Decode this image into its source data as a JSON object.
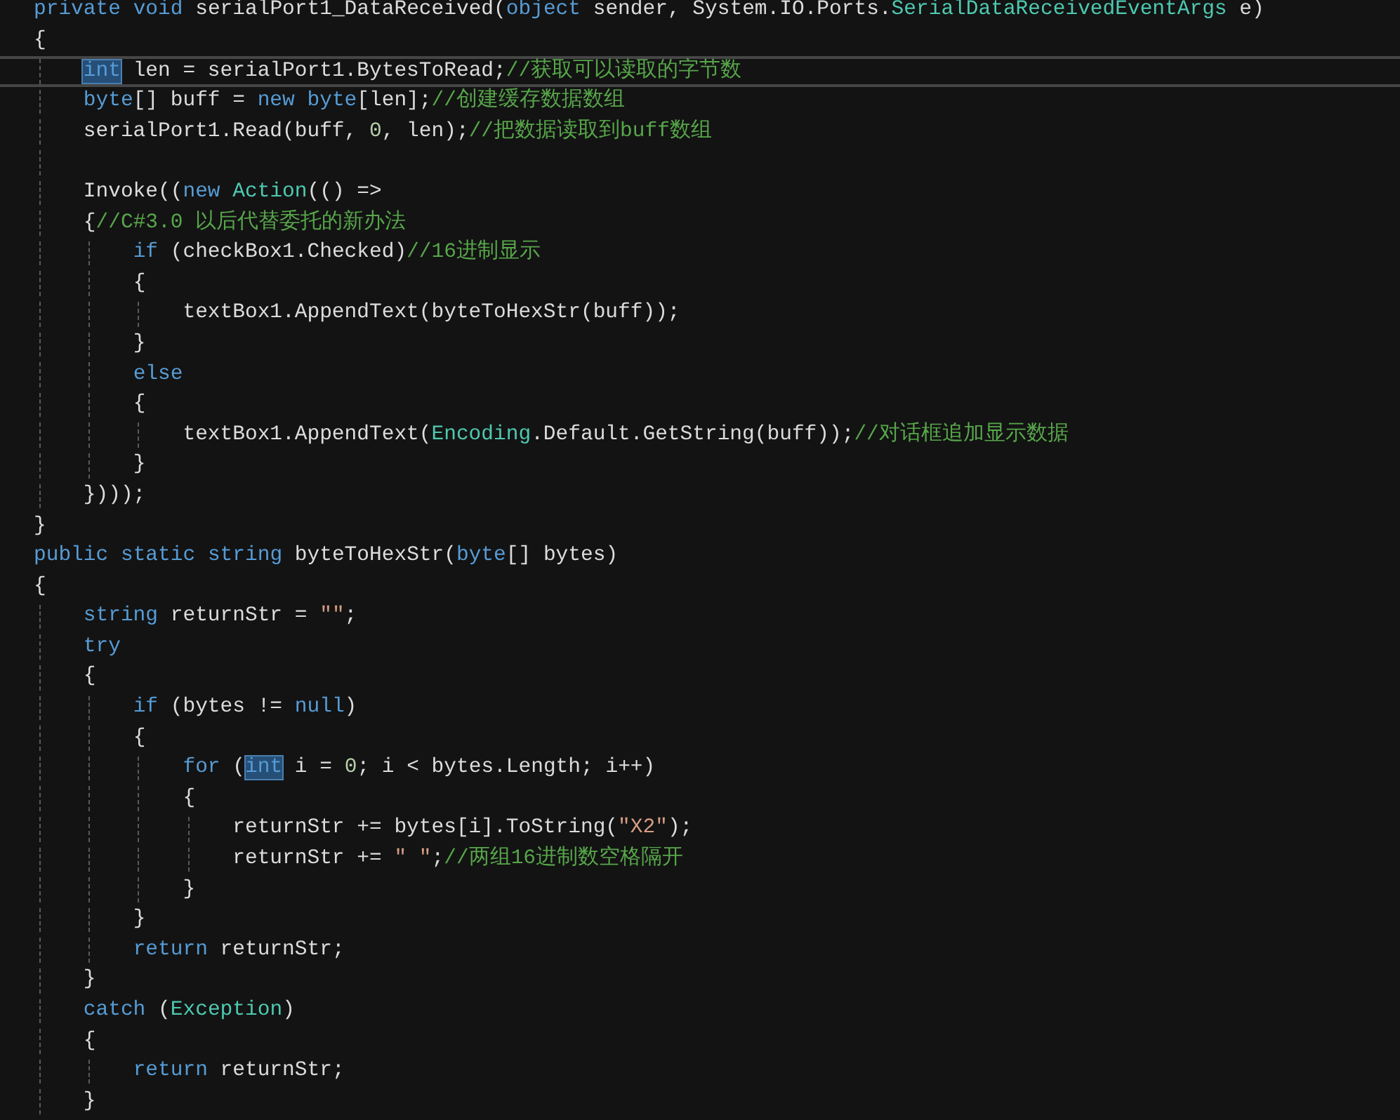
{
  "editor": {
    "lines": [
      {
        "current": false,
        "tokens": [
          {
            "kind": "keyword",
            "text": "private"
          },
          {
            "kind": "keyword",
            "text": " void"
          },
          {
            "kind": "plain",
            "text": " serialPort1_DataReceived("
          },
          {
            "kind": "keyword",
            "text": "object"
          },
          {
            "kind": "plain",
            "text": " sender, System.IO.Ports."
          },
          {
            "kind": "type",
            "text": "SerialDataReceivedEventArgs"
          },
          {
            "kind": "plain",
            "text": " e)"
          }
        ]
      },
      {
        "current": false,
        "tokens": [
          {
            "kind": "plain",
            "text": "{"
          }
        ]
      },
      {
        "current": true,
        "tokens": [
          {
            "kind": "match",
            "text": "    int"
          },
          {
            "kind": "plain",
            "text": " len = serialPort1.BytesToRead;"
          },
          {
            "kind": "comment",
            "text": "//获取可以读取的字节数"
          }
        ]
      },
      {
        "current": false,
        "tokens": [
          {
            "kind": "keyword",
            "text": "    byte"
          },
          {
            "kind": "plain",
            "text": "[] buff = "
          },
          {
            "kind": "keyword",
            "text": "new"
          },
          {
            "kind": "keyword",
            "text": " byte"
          },
          {
            "kind": "plain",
            "text": "[len];"
          },
          {
            "kind": "comment",
            "text": "//创建缓存数据数组"
          }
        ]
      },
      {
        "current": false,
        "tokens": [
          {
            "kind": "plain",
            "text": "    serialPort1.Read(buff, "
          },
          {
            "kind": "number",
            "text": "0"
          },
          {
            "kind": "plain",
            "text": ", len);"
          },
          {
            "kind": "comment",
            "text": "//把数据读取到buff数组"
          }
        ]
      },
      {
        "current": false
      },
      {
        "current": false,
        "tokens": [
          {
            "kind": "plain",
            "text": "    Invoke(("
          },
          {
            "kind": "keyword",
            "text": "new"
          },
          {
            "kind": "type",
            "text": " Action"
          },
          {
            "kind": "plain",
            "text": "(() =>"
          }
        ]
      },
      {
        "current": false,
        "tokens": [
          {
            "kind": "plain",
            "text": "    {"
          },
          {
            "kind": "comment",
            "text": "//C#3.0 以后代替委托的新办法"
          }
        ]
      },
      {
        "current": false,
        "tokens": [
          {
            "kind": "keyword",
            "text": "        if"
          },
          {
            "kind": "plain",
            "text": " (checkBox1.Checked)"
          },
          {
            "kind": "comment",
            "text": "//16进制显示"
          }
        ]
      },
      {
        "current": false,
        "tokens": [
          {
            "kind": "plain",
            "text": "        {"
          }
        ]
      },
      {
        "current": false,
        "tokens": [
          {
            "kind": "plain",
            "text": "            textBox1.AppendText(byteToHexStr(buff));"
          }
        ]
      },
      {
        "current": false,
        "tokens": [
          {
            "kind": "plain",
            "text": "        }"
          }
        ]
      },
      {
        "current": false,
        "tokens": [
          {
            "kind": "keyword",
            "text": "        else"
          }
        ]
      },
      {
        "current": false,
        "tokens": [
          {
            "kind": "plain",
            "text": "        {"
          }
        ]
      },
      {
        "current": false,
        "tokens": [
          {
            "kind": "plain",
            "text": "            textBox1.AppendText("
          },
          {
            "kind": "type",
            "text": "Encoding"
          },
          {
            "kind": "plain",
            "text": ".Default.GetString(buff));"
          },
          {
            "kind": "comment",
            "text": "//对话框追加显示数据"
          }
        ]
      },
      {
        "current": false,
        "tokens": [
          {
            "kind": "plain",
            "text": "        }"
          }
        ]
      },
      {
        "current": false,
        "tokens": [
          {
            "kind": "plain",
            "text": "    })));"
          }
        ]
      },
      {
        "current": false,
        "tokens": [
          {
            "kind": "plain",
            "text": "}"
          }
        ]
      },
      {
        "current": false,
        "tokens": [
          {
            "kind": "keyword",
            "text": "public"
          },
          {
            "kind": "keyword",
            "text": " static"
          },
          {
            "kind": "keyword",
            "text": " string"
          },
          {
            "kind": "plain",
            "text": " byteToHexStr("
          },
          {
            "kind": "keyword",
            "text": "byte"
          },
          {
            "kind": "plain",
            "text": "[] bytes)"
          }
        ]
      },
      {
        "current": false,
        "tokens": [
          {
            "kind": "plain",
            "text": "{"
          }
        ]
      },
      {
        "current": false,
        "tokens": [
          {
            "kind": "keyword",
            "text": "    string"
          },
          {
            "kind": "plain",
            "text": " returnStr = "
          },
          {
            "kind": "string",
            "text": "\"\""
          },
          {
            "kind": "plain",
            "text": ";"
          }
        ]
      },
      {
        "current": false,
        "tokens": [
          {
            "kind": "keyword",
            "text": "    try"
          }
        ]
      },
      {
        "current": false,
        "tokens": [
          {
            "kind": "plain",
            "text": "    {"
          }
        ]
      },
      {
        "current": false,
        "tokens": [
          {
            "kind": "keyword",
            "text": "        if"
          },
          {
            "kind": "plain",
            "text": " (bytes != "
          },
          {
            "kind": "keyword",
            "text": "null"
          },
          {
            "kind": "plain",
            "text": ")"
          }
        ]
      },
      {
        "current": false,
        "tokens": [
          {
            "kind": "plain",
            "text": "        {"
          }
        ]
      },
      {
        "current": false,
        "tokens": [
          {
            "kind": "keyword",
            "text": "            for"
          },
          {
            "kind": "plain",
            "text": " ("
          },
          {
            "kind": "match",
            "text": "int"
          },
          {
            "kind": "plain",
            "text": " i = "
          },
          {
            "kind": "number",
            "text": "0"
          },
          {
            "kind": "plain",
            "text": "; i < bytes.Length; i++)"
          }
        ]
      },
      {
        "current": false,
        "tokens": [
          {
            "kind": "plain",
            "text": "            {"
          }
        ]
      },
      {
        "current": false,
        "tokens": [
          {
            "kind": "plain",
            "text": "                returnStr += bytes[i].ToString("
          },
          {
            "kind": "string",
            "text": "\"X2\""
          },
          {
            "kind": "plain",
            "text": ");"
          }
        ]
      },
      {
        "current": false,
        "tokens": [
          {
            "kind": "plain",
            "text": "                returnStr += "
          },
          {
            "kind": "string",
            "text": "\" \""
          },
          {
            "kind": "plain",
            "text": ";"
          },
          {
            "kind": "comment",
            "text": "//两组16进制数空格隔开"
          }
        ]
      },
      {
        "current": false,
        "tokens": [
          {
            "kind": "plain",
            "text": "            }"
          }
        ]
      },
      {
        "current": false,
        "tokens": [
          {
            "kind": "plain",
            "text": "        }"
          }
        ]
      },
      {
        "current": false,
        "tokens": [
          {
            "kind": "keyword",
            "text": "        return"
          },
          {
            "kind": "plain",
            "text": " returnStr;"
          }
        ]
      },
      {
        "current": false,
        "tokens": [
          {
            "kind": "plain",
            "text": "    }"
          }
        ]
      },
      {
        "current": false,
        "tokens": [
          {
            "kind": "keyword",
            "text": "    catch"
          },
          {
            "kind": "plain",
            "text": " ("
          },
          {
            "kind": "type",
            "text": "Exception"
          },
          {
            "kind": "plain",
            "text": ")"
          }
        ]
      },
      {
        "current": false,
        "tokens": [
          {
            "kind": "plain",
            "text": "    {"
          }
        ]
      },
      {
        "current": false,
        "tokens": [
          {
            "kind": "keyword",
            "text": "        return"
          },
          {
            "kind": "plain",
            "text": " returnStr;"
          }
        ]
      },
      {
        "current": false,
        "tokens": [
          {
            "kind": "plain",
            "text": "    }"
          }
        ]
      }
    ]
  }
}
